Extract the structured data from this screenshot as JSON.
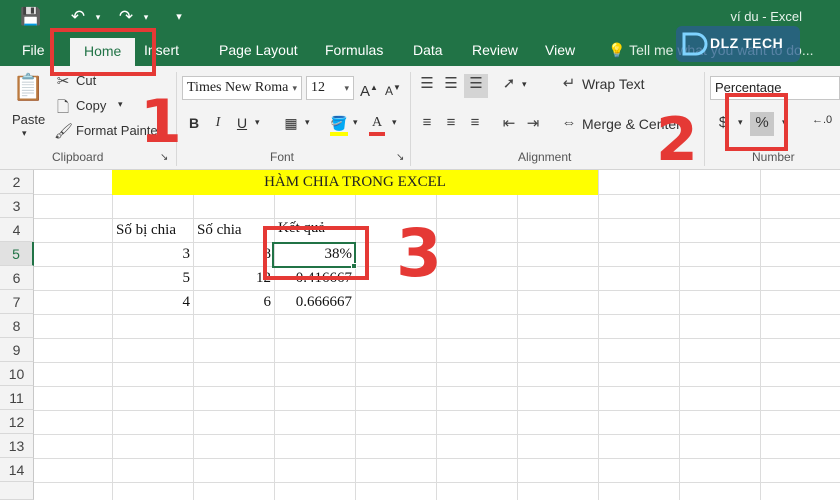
{
  "titlebar": {
    "title": "ví du  -  Excel",
    "save_icon": "save-icon",
    "undo_icon": "undo-icon",
    "redo_icon": "redo-icon",
    "customize_icon": "customize-qat-icon"
  },
  "tabs": [
    {
      "label": "File"
    },
    {
      "label": "Home"
    },
    {
      "label": "Insert"
    },
    {
      "label": "Page Layout"
    },
    {
      "label": "Formulas"
    },
    {
      "label": "Data"
    },
    {
      "label": "Review"
    },
    {
      "label": "View"
    }
  ],
  "tellme": "Tell me what you want to do...",
  "clipboard": {
    "paste": "Paste",
    "cut": "Cut",
    "copy": "Copy",
    "format_painter": "Format Painter",
    "group_label": "Clipboard"
  },
  "font": {
    "font_name": "Times New Roma",
    "font_size": "12",
    "group_label": "Font",
    "bold": "B",
    "italic": "I",
    "underline": "U",
    "grow": "A",
    "shrink": "A"
  },
  "alignment": {
    "wrap_text": "Wrap Text",
    "merge_center": "Merge & Center",
    "group_label": "Alignment"
  },
  "number": {
    "format": "Percentage",
    "currency": "$",
    "percent": "%",
    "group_label": "Number"
  },
  "watermark": {
    "text": "DLZ TECH"
  },
  "annotations": [
    "1",
    "2",
    "3"
  ],
  "sheet": {
    "rows": [
      "2",
      "3",
      "4",
      "5",
      "6",
      "7",
      "8",
      "9",
      "10",
      "11",
      "12",
      "13",
      "14"
    ],
    "selected_row": "5",
    "title": "HÀM CHIA TRONG EXCEL",
    "headers": {
      "dividend": "Số bị chia",
      "divisor": "Số chia",
      "result": "Kết quả"
    },
    "data": [
      {
        "dividend": "3",
        "divisor": "8",
        "result": "38%"
      },
      {
        "dividend": "5",
        "divisor": "12",
        "result": "0.416667"
      },
      {
        "dividend": "4",
        "divisor": "6",
        "result": "0.666667"
      }
    ]
  }
}
